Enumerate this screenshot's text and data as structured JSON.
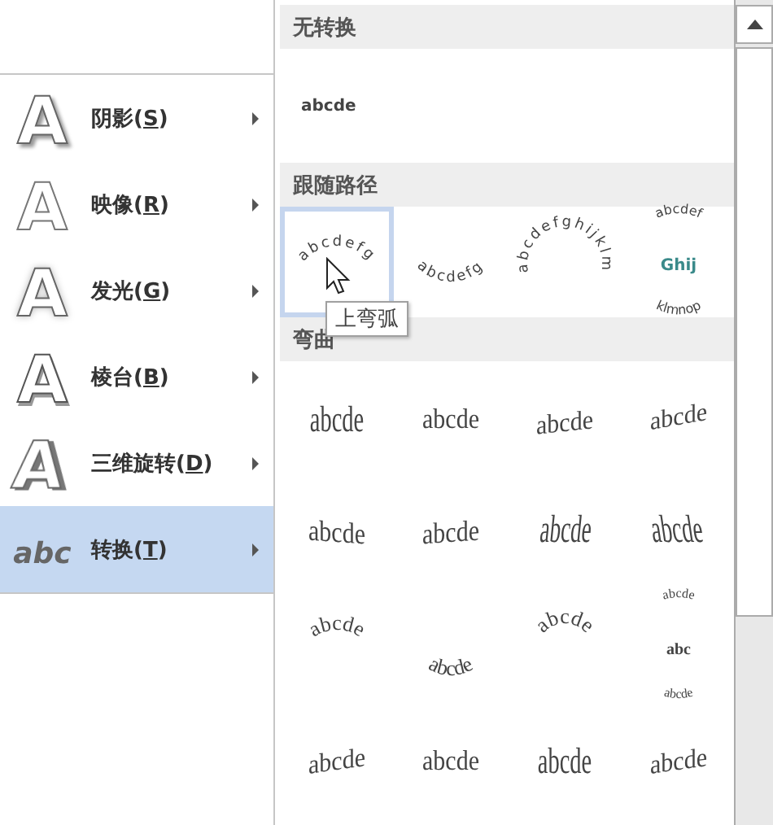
{
  "menu": {
    "items": [
      {
        "text_before": "阴影(",
        "accesskey": "S",
        "text_after": ")",
        "icon": {
          "glyph": "A",
          "kind": "shadow"
        },
        "selected": false
      },
      {
        "text_before": "映像(",
        "accesskey": "R",
        "text_after": ")",
        "icon": {
          "glyph": "A",
          "kind": "reflection"
        },
        "selected": false
      },
      {
        "text_before": "发光(",
        "accesskey": "G",
        "text_after": ")",
        "icon": {
          "glyph": "A",
          "kind": "glow"
        },
        "selected": false
      },
      {
        "text_before": "棱台(",
        "accesskey": "B",
        "text_after": ")",
        "icon": {
          "glyph": "A",
          "kind": "bevel"
        },
        "selected": false
      },
      {
        "text_before": "三维旋转(",
        "accesskey": "D",
        "text_after": ")",
        "icon": {
          "glyph": "A",
          "kind": "rotate3d"
        },
        "selected": false
      },
      {
        "text_before": "转换(",
        "accesskey": "T",
        "text_after": ")",
        "icon": {
          "glyph": "abc",
          "kind": "transform"
        },
        "selected": true
      }
    ]
  },
  "gallery": {
    "sections": [
      {
        "title": "无转换",
        "items": [
          {
            "kind": "none",
            "lines": [
              "abcde"
            ],
            "selected": false
          }
        ]
      },
      {
        "title": "跟随路径",
        "items": [
          {
            "kind": "arch-up",
            "lines": [
              "abcdefg"
            ],
            "selected": true
          },
          {
            "kind": "arch-down",
            "lines": [
              "abcdefg"
            ],
            "selected": false
          },
          {
            "kind": "circle",
            "lines": [
              "abcdefghijklm"
            ],
            "selected": false
          },
          {
            "kind": "button",
            "lines": [
              "abcdef",
              "Ghij",
              "klmnop"
            ],
            "selected": false
          }
        ]
      },
      {
        "title": "弯曲",
        "items": [
          {
            "kind": "stretch",
            "lines": [
              "abcde"
            ],
            "selected": false
          },
          {
            "kind": "squeeze",
            "lines": [
              "abcde"
            ],
            "selected": false
          },
          {
            "kind": "slant-up",
            "lines": [
              "abcde"
            ],
            "selected": false
          },
          {
            "kind": "slant-down",
            "lines": [
              "abcde"
            ],
            "selected": false
          },
          {
            "kind": "wave-down",
            "lines": [
              "abcde"
            ],
            "selected": false
          },
          {
            "kind": "wave-up",
            "lines": [
              "abcde"
            ],
            "selected": false
          },
          {
            "kind": "ring",
            "lines": [
              "abcde"
            ],
            "selected": false
          },
          {
            "kind": "ring-tilt",
            "lines": [
              "abcde"
            ],
            "selected": false
          },
          {
            "kind": "warp-arch-up",
            "lines": [
              "abcde"
            ],
            "selected": false
          },
          {
            "kind": "warp-arch-down",
            "lines": [
              "abcde"
            ],
            "selected": false
          },
          {
            "kind": "warp-circle",
            "lines": [
              "abcde"
            ],
            "selected": false
          },
          {
            "kind": "warp-button",
            "lines": [
              "abcde",
              "abc",
              "abcde"
            ],
            "selected": false
          },
          {
            "kind": "grow",
            "lines": [
              "abcde"
            ],
            "selected": false
          },
          {
            "kind": "squeeze",
            "lines": [
              "abcde"
            ],
            "selected": false
          },
          {
            "kind": "stretch",
            "lines": [
              "abcde"
            ],
            "selected": false
          },
          {
            "kind": "grow",
            "lines": [
              "abcde"
            ],
            "selected": false
          }
        ]
      }
    ]
  },
  "tooltip": {
    "text": "上弯弧"
  }
}
